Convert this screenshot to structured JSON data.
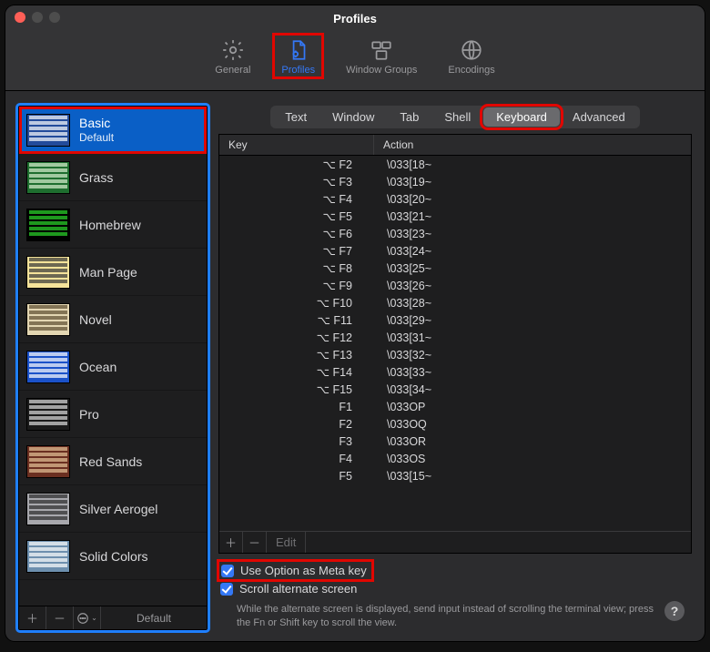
{
  "window": {
    "title": "Profiles"
  },
  "toolbar": {
    "items": [
      {
        "label": "General"
      },
      {
        "label": "Profiles",
        "selected": true
      },
      {
        "label": "Window Groups"
      },
      {
        "label": "Encodings"
      }
    ]
  },
  "sidebar": {
    "profiles": [
      {
        "name": "Basic",
        "subtitle": "Default",
        "selected": true,
        "swatch_bg": "#234b9b",
        "swatch_fg": "#ffffff"
      },
      {
        "name": "Grass",
        "swatch_bg": "#1e6e2f",
        "swatch_fg": "#d9f0d0"
      },
      {
        "name": "Homebrew",
        "swatch_bg": "#000000",
        "swatch_fg": "#2bd92b"
      },
      {
        "name": "Man Page",
        "swatch_bg": "#f5e39a",
        "swatch_fg": "#333333"
      },
      {
        "name": "Novel",
        "swatch_bg": "#e3d6b2",
        "swatch_fg": "#5a4a2e"
      },
      {
        "name": "Ocean",
        "swatch_bg": "#1b52c9",
        "swatch_fg": "#ffffff"
      },
      {
        "name": "Pro",
        "swatch_bg": "#1a1a1a",
        "swatch_fg": "#dddddd"
      },
      {
        "name": "Red Sands",
        "swatch_bg": "#6b2f21",
        "swatch_fg": "#e6c39a"
      },
      {
        "name": "Silver Aerogel",
        "swatch_bg": "#a8a8ad",
        "swatch_fg": "#2a2a2a"
      },
      {
        "name": "Solid Colors",
        "swatch_bg": "#6d8fae",
        "swatch_fg": "#ffffff"
      }
    ],
    "footer_default": "Default"
  },
  "tabs": {
    "items": [
      {
        "label": "Text"
      },
      {
        "label": "Window"
      },
      {
        "label": "Tab"
      },
      {
        "label": "Shell"
      },
      {
        "label": "Keyboard",
        "selected": true
      },
      {
        "label": "Advanced"
      }
    ]
  },
  "table": {
    "columns": {
      "key": "Key",
      "action": "Action"
    },
    "rows": [
      {
        "key": "⌥ F2",
        "action": "\\033[18~"
      },
      {
        "key": "⌥ F3",
        "action": "\\033[19~"
      },
      {
        "key": "⌥ F4",
        "action": "\\033[20~"
      },
      {
        "key": "⌥ F5",
        "action": "\\033[21~"
      },
      {
        "key": "⌥ F6",
        "action": "\\033[23~"
      },
      {
        "key": "⌥ F7",
        "action": "\\033[24~"
      },
      {
        "key": "⌥ F8",
        "action": "\\033[25~"
      },
      {
        "key": "⌥ F9",
        "action": "\\033[26~"
      },
      {
        "key": "⌥ F10",
        "action": "\\033[28~"
      },
      {
        "key": "⌥ F11",
        "action": "\\033[29~"
      },
      {
        "key": "⌥ F12",
        "action": "\\033[31~"
      },
      {
        "key": "⌥ F13",
        "action": "\\033[32~"
      },
      {
        "key": "⌥ F14",
        "action": "\\033[33~"
      },
      {
        "key": "⌥ F15",
        "action": "\\033[34~"
      },
      {
        "key": "F1",
        "action": "\\033OP"
      },
      {
        "key": "F2",
        "action": "\\033OQ"
      },
      {
        "key": "F3",
        "action": "\\033OR"
      },
      {
        "key": "F4",
        "action": "\\033OS"
      },
      {
        "key": "F5",
        "action": "\\033[15~"
      }
    ],
    "footer": {
      "edit": "Edit"
    }
  },
  "options": {
    "use_option_meta": {
      "label": "Use Option as Meta key",
      "checked": true
    },
    "scroll_alternate": {
      "label": "Scroll alternate screen",
      "checked": true
    },
    "hint": "While the alternate screen is displayed, send input instead of scrolling the terminal view; press the Fn or Shift key to scroll the view."
  },
  "help_glyph": "?"
}
